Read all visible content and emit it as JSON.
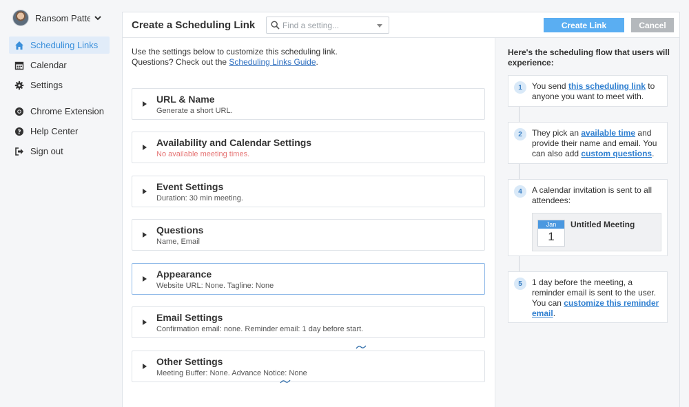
{
  "user": {
    "name": "Ransom Patte..."
  },
  "nav": [
    {
      "label": "Scheduling Links",
      "icon": "home-icon",
      "active": true
    },
    {
      "label": "Calendar",
      "icon": "calendar-icon"
    },
    {
      "label": "Settings",
      "icon": "gear-icon"
    },
    {
      "label": "Chrome Extension",
      "icon": "chrome-icon"
    },
    {
      "label": "Help Center",
      "icon": "question-circle-icon"
    },
    {
      "label": "Sign out",
      "icon": "sign-out-icon"
    }
  ],
  "header": {
    "title": "Create a Scheduling Link",
    "search_placeholder": "Find a setting...",
    "create_label": "Create Link",
    "cancel_label": "Cancel"
  },
  "intro": {
    "line1": "Use the settings below to customize this scheduling link.",
    "line2_prefix": "Questions? Check out the ",
    "guide_link": "Scheduling Links Guide",
    "line2_suffix": "."
  },
  "sections": [
    {
      "title": "URL & Name",
      "subtitle": "Generate a short URL."
    },
    {
      "title": "Availability and Calendar Settings",
      "subtitle": "No available meeting times."
    },
    {
      "title": "Event Settings",
      "subtitle": "Duration: 30 min meeting."
    },
    {
      "title": "Questions",
      "subtitle": "Name, Email"
    },
    {
      "title": "Appearance",
      "subtitle": "Website URL: None. Tagline: None"
    },
    {
      "title": "Email Settings",
      "subtitle": "Confirmation email: none. Reminder email: 1 day before start."
    },
    {
      "title": "Other Settings",
      "subtitle": "Meeting Buffer: None. Advance Notice: None"
    }
  ],
  "flow": {
    "title": "Here's the scheduling flow that users will experience:",
    "step1": {
      "num": "1",
      "t1": "You send ",
      "link": "this scheduling link",
      "t2": " to anyone you want to meet with."
    },
    "step2": {
      "num": "2",
      "t1": "They pick an ",
      "link1": "available time",
      "t2": " and provide their name and email. You can also add ",
      "link2": "custom questions",
      "t3": "."
    },
    "step4": {
      "num": "4",
      "text": "A calendar invitation is sent to all attendees:",
      "cal_month": "Jan",
      "cal_day": "1",
      "meeting_title": "Untitled Meeting"
    },
    "step5": {
      "num": "5",
      "t1": "1 day before the meeting, a reminder email is sent to the user. You can ",
      "link": "customize this reminder email",
      "t2": "."
    }
  },
  "colors": {
    "accent": "#5aaef2",
    "active_bg": "#e1ecf9",
    "warn": "#e57373",
    "link": "#2f7fd0"
  }
}
